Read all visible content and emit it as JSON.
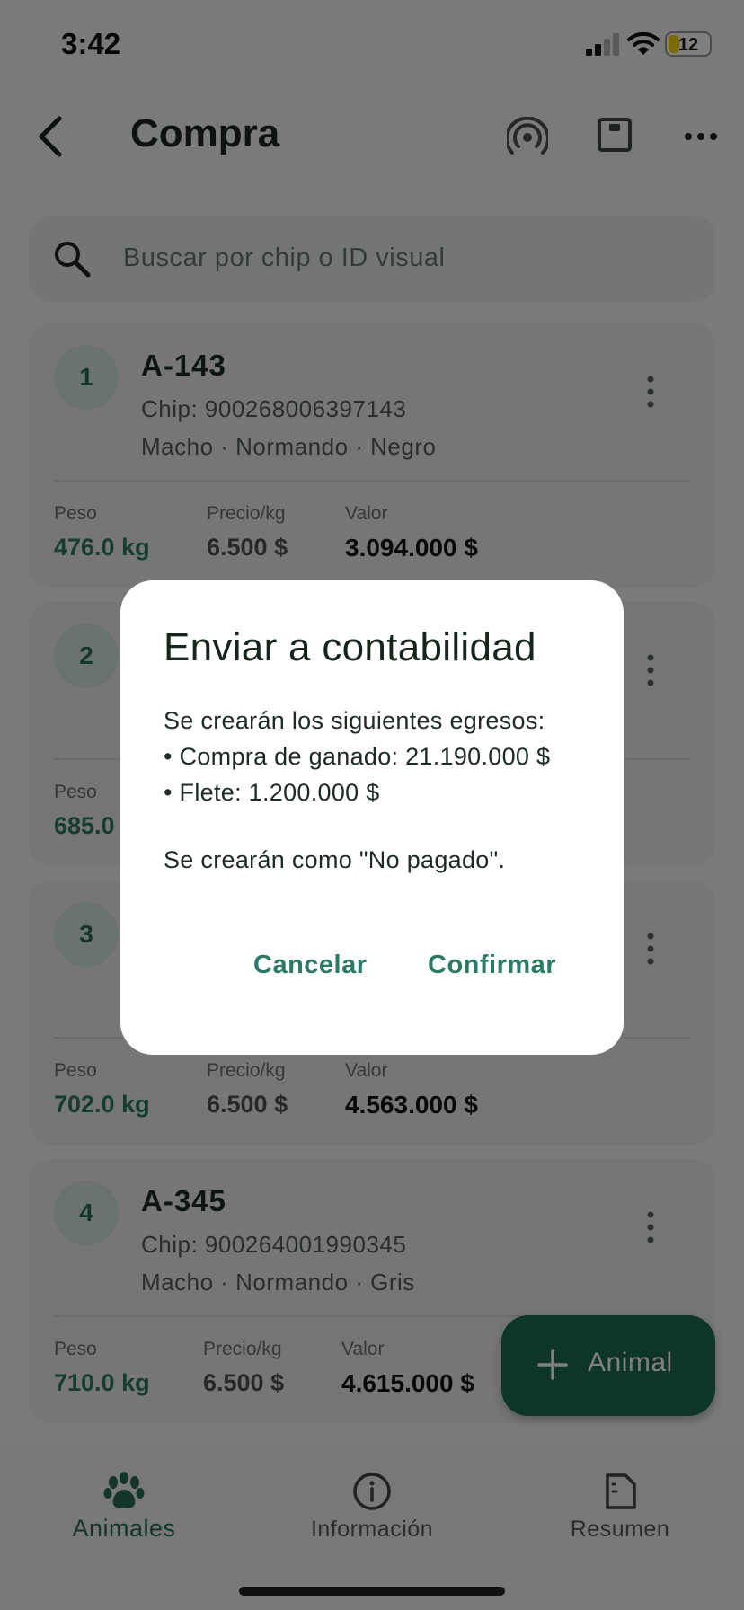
{
  "status_bar": {
    "time": "3:42",
    "battery": "12",
    "battery_color": "#f7d400"
  },
  "app_bar": {
    "title": "Compra",
    "icons": [
      "back-arrow-icon",
      "nfc-icon",
      "scan-icon",
      "more-icon"
    ]
  },
  "search": {
    "placeholder": "Buscar por chip o ID visual"
  },
  "cards": [
    {
      "number": "1",
      "id": "A-143",
      "chip": "Chip: 900268006397143",
      "desc": "Macho · Normando · Negro",
      "peso_label": "Peso",
      "peso": "476.0 kg",
      "precio_label": "Precio/kg",
      "precio": "6.500 $",
      "valor_label": "Valor",
      "valor": "3.094.000 $"
    },
    {
      "number": "2",
      "peso_label": "Peso",
      "peso": "685.0"
    },
    {
      "number": "3",
      "peso_label": "Peso",
      "peso": "702.0 kg",
      "precio_label": "Precio/kg",
      "precio": "6.500 $",
      "valor_label": "Valor",
      "valor": "4.563.000 $"
    },
    {
      "number": "4",
      "id": "A-345",
      "chip": "Chip: 900264001990345",
      "desc": "Macho · Normando · Gris",
      "peso_label": "Peso",
      "peso": "710.0 kg",
      "precio_label": "Precio/kg",
      "precio": "6.500 $",
      "valor_label": "Valor",
      "valor": "4.615.000 $"
    }
  ],
  "fab": {
    "label": "Animal",
    "icon": "plus-icon"
  },
  "bottom_nav": [
    {
      "label": "Animales",
      "icon": "paw-icon",
      "active": true
    },
    {
      "label": "Información",
      "icon": "info-icon",
      "active": false
    },
    {
      "label": "Resumen",
      "icon": "document-icon",
      "active": false
    }
  ],
  "dialog": {
    "title": "Enviar a contabilidad",
    "body_lines": [
      "Se crearán los siguientes egresos:",
      "• Compra de ganado: 21.190.000 $",
      "• Flete: 1.200.000 $"
    ],
    "note": "Se crearán como \"No pagado\".",
    "cancel_label": "Cancelar",
    "confirm_label": "Confirmar"
  },
  "colors": {
    "accent": "#2b7a66",
    "fab": "#1d6b55",
    "badge_bg": "#d6e6dd"
  }
}
